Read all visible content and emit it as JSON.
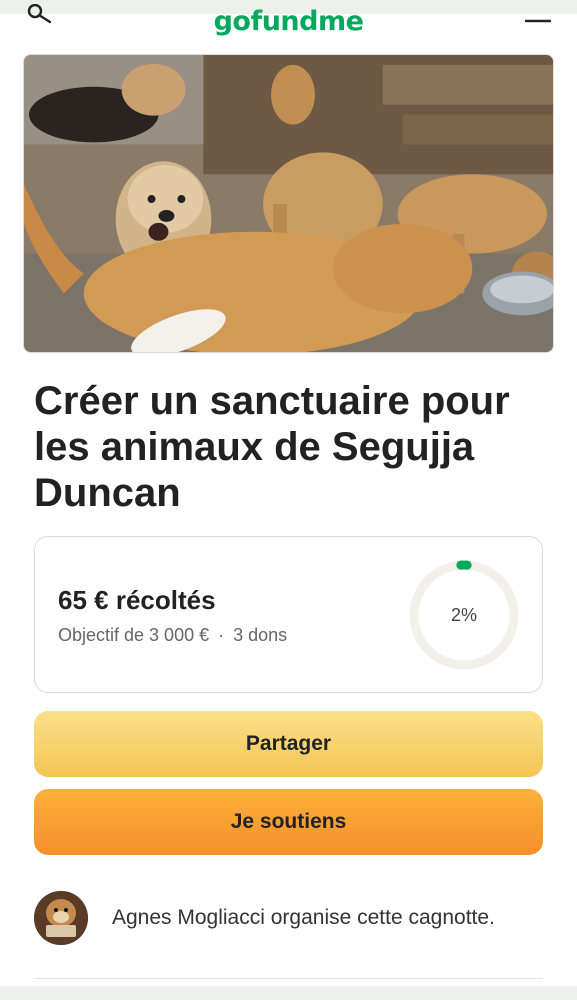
{
  "header": {
    "logo_text": "gofundme",
    "brand_color": "#02a95c",
    "search_icon": "search-icon",
    "menu_icon": "menu-icon"
  },
  "campaign": {
    "title": "Créer un sanctuaire pour les animaux de Segujja Duncan",
    "image_alt": "dogs-in-shelter-photo"
  },
  "progress": {
    "raised_text": "65 € récoltés",
    "goal_text": "Objectif de 3 000 €",
    "separator": "·",
    "donations_text": "3 dons",
    "percent_label": "2%",
    "percent_value": 2,
    "ring_color": "#02a95c",
    "track_color": "#f1f1ea"
  },
  "actions": {
    "share_label": "Partager",
    "donate_label": "Je soutiens"
  },
  "organizer": {
    "text": "Agnes Mogliacci organise cette cagnotte."
  }
}
